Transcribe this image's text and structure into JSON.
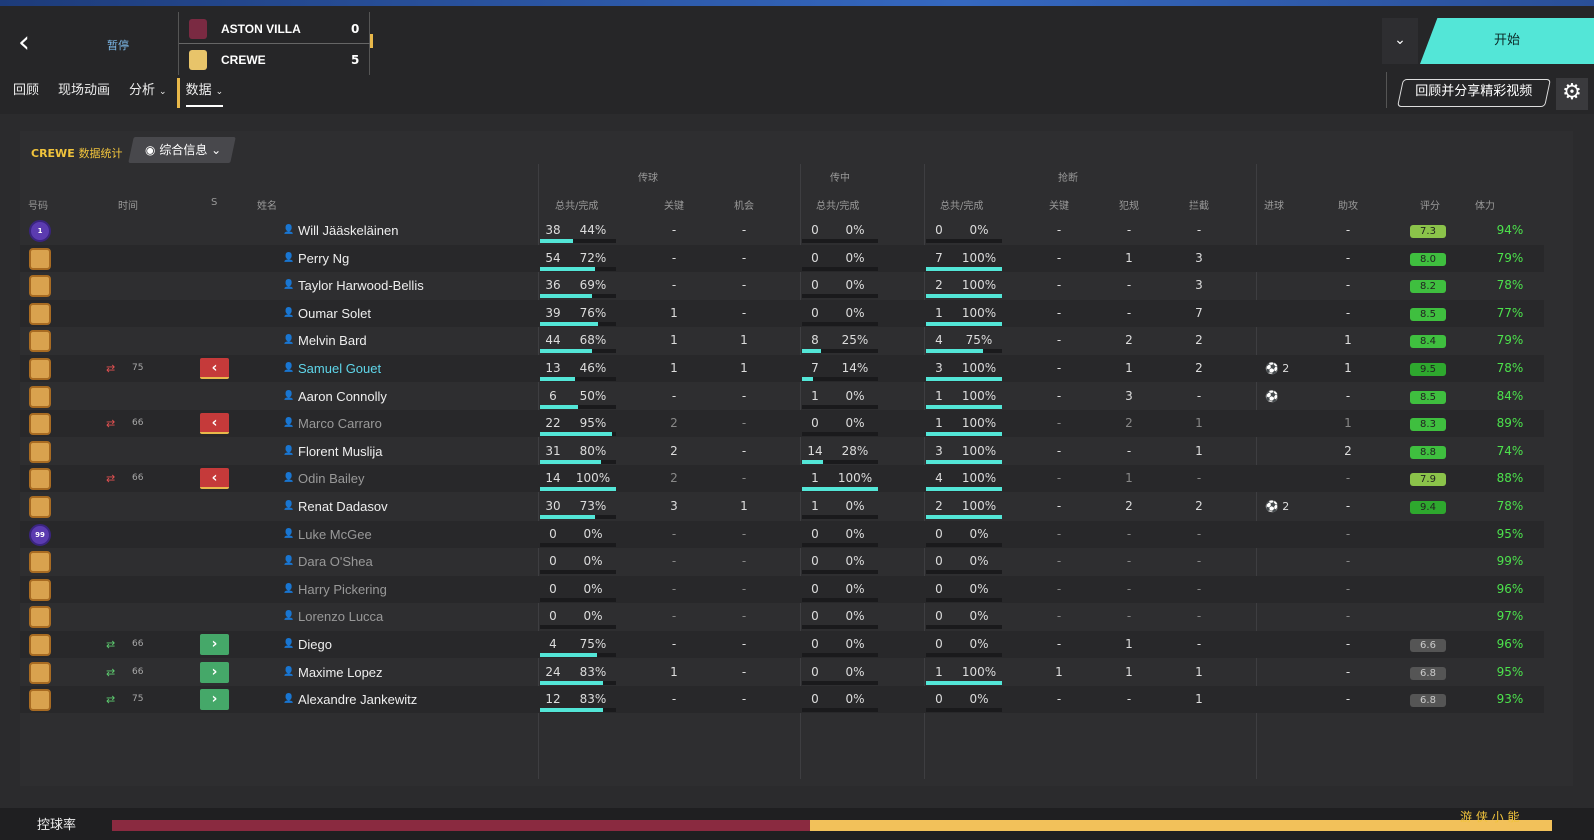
{
  "header": {
    "back_icon": "chevron-left-icon",
    "match_status": "暂停",
    "home_team": {
      "name": "ASTON VILLA",
      "score": "0",
      "crest_color": "#7a2a42"
    },
    "away_team": {
      "name": "CREWE",
      "score": "5",
      "crest_color": "#e8c46a"
    },
    "start_button": "开始",
    "share_button": "回顾并分享精彩视频",
    "tabs": [
      {
        "label": "回顾",
        "dropdown": false
      },
      {
        "label": "现场动画",
        "dropdown": false
      },
      {
        "label": "分析",
        "dropdown": true
      },
      {
        "label": "数据",
        "dropdown": true,
        "active": true
      }
    ]
  },
  "panel": {
    "team": "CREWE",
    "title": "数据统计",
    "view_selector": "综合信息",
    "groups": {
      "passing": "传球",
      "crossing": "传中",
      "tackles": "抢断"
    },
    "columns": {
      "number": "号码",
      "time": "时间",
      "s": "S",
      "name": "姓名",
      "pass_total": "总共/完成",
      "key": "关键",
      "chances": "机会",
      "cross_total": "总共/完成",
      "tackle_total": "总共/完成",
      "tackle_key": "关键",
      "fouls": "犯规",
      "interceptions": "拦截",
      "goals": "进球",
      "assists": "助攻",
      "rating": "评分",
      "stamina": "体力"
    }
  },
  "players": [
    {
      "no": "1",
      "gk": true,
      "name": "Will Jääskeläinen",
      "sub": false,
      "time": "",
      "sbtn": "",
      "pt": "38",
      "pp": "44%",
      "pf": 0.44,
      "key": "-",
      "ch": "-",
      "ct": "0",
      "cp": "0%",
      "cf": 0,
      "tt": "0",
      "tp": "0%",
      "tf": 0,
      "tk": "-",
      "fo": "-",
      "ic": "-",
      "gl": "",
      "as": "-",
      "rt": "7.3",
      "rc": "#8bc34a",
      "st": "94%"
    },
    {
      "no": "",
      "gk": false,
      "name": "Perry Ng",
      "sub": false,
      "time": "",
      "sbtn": "",
      "pt": "54",
      "pp": "72%",
      "pf": 0.72,
      "key": "-",
      "ch": "-",
      "ct": "0",
      "cp": "0%",
      "cf": 0,
      "tt": "7",
      "tp": "100%",
      "tf": 1,
      "tk": "-",
      "fo": "1",
      "ic": "3",
      "gl": "",
      "as": "-",
      "rt": "8.0",
      "rc": "#3fbf3f",
      "st": "79%"
    },
    {
      "no": "",
      "gk": false,
      "name": "Taylor Harwood-Bellis",
      "sub": false,
      "time": "",
      "sbtn": "",
      "pt": "36",
      "pp": "69%",
      "pf": 0.69,
      "key": "-",
      "ch": "-",
      "ct": "0",
      "cp": "0%",
      "cf": 0,
      "tt": "2",
      "tp": "100%",
      "tf": 1,
      "tk": "-",
      "fo": "-",
      "ic": "3",
      "gl": "",
      "as": "-",
      "rt": "8.2",
      "rc": "#3fbf3f",
      "st": "78%"
    },
    {
      "no": "",
      "gk": false,
      "name": "Oumar Solet",
      "sub": false,
      "time": "",
      "sbtn": "",
      "pt": "39",
      "pp": "76%",
      "pf": 0.76,
      "key": "1",
      "ch": "-",
      "ct": "0",
      "cp": "0%",
      "cf": 0,
      "tt": "1",
      "tp": "100%",
      "tf": 1,
      "tk": "-",
      "fo": "-",
      "ic": "7",
      "gl": "",
      "as": "-",
      "rt": "8.5",
      "rc": "#3fbf3f",
      "st": "77%"
    },
    {
      "no": "",
      "gk": false,
      "name": "Melvin Bard",
      "sub": false,
      "time": "",
      "sbtn": "",
      "pt": "44",
      "pp": "68%",
      "pf": 0.68,
      "key": "1",
      "ch": "1",
      "ct": "8",
      "cp": "25%",
      "cf": 0.25,
      "tt": "4",
      "tp": "75%",
      "tf": 0.75,
      "tk": "-",
      "fo": "2",
      "ic": "2",
      "gl": "",
      "as": "1",
      "rt": "8.4",
      "rc": "#3fbf3f",
      "st": "79%"
    },
    {
      "no": "",
      "gk": false,
      "name": "Samuel Gouet",
      "sub": "off",
      "hl": true,
      "time": "75",
      "sbtn": "out",
      "pt": "13",
      "pp": "46%",
      "pf": 0.46,
      "key": "1",
      "ch": "1",
      "ct": "7",
      "cp": "14%",
      "cf": 0.14,
      "tt": "3",
      "tp": "100%",
      "tf": 1,
      "tk": "-",
      "fo": "1",
      "ic": "2",
      "gl": "2",
      "as": "1",
      "rt": "9.5",
      "rc": "#2ea82e",
      "st": "78%"
    },
    {
      "no": "",
      "gk": false,
      "name": "Aaron Connolly",
      "sub": false,
      "time": "",
      "sbtn": "",
      "pt": "6",
      "pp": "50%",
      "pf": 0.5,
      "key": "-",
      "ch": "-",
      "ct": "1",
      "cp": "0%",
      "cf": 0,
      "tt": "1",
      "tp": "100%",
      "tf": 1,
      "tk": "-",
      "fo": "3",
      "ic": "-",
      "gl": "1",
      "as": "-",
      "rt": "8.5",
      "rc": "#3fbf3f",
      "st": "84%"
    },
    {
      "no": "",
      "gk": false,
      "name": "Marco Carraro",
      "sub": "off",
      "dim": true,
      "time": "66",
      "sbtn": "out",
      "pt": "22",
      "pp": "95%",
      "pf": 0.95,
      "key": "2",
      "ch": "-",
      "ct": "0",
      "cp": "0%",
      "cf": 0,
      "tt": "1",
      "tp": "100%",
      "tf": 1,
      "tk": "-",
      "fo": "2",
      "ic": "1",
      "gl": "",
      "as": "1",
      "rt": "8.3",
      "rc": "#3fbf3f",
      "st": "89%"
    },
    {
      "no": "",
      "gk": false,
      "name": "Florent Muslija",
      "sub": false,
      "time": "",
      "sbtn": "",
      "pt": "31",
      "pp": "80%",
      "pf": 0.8,
      "key": "2",
      "ch": "-",
      "ct": "14",
      "cp": "28%",
      "cf": 0.28,
      "tt": "3",
      "tp": "100%",
      "tf": 1,
      "tk": "-",
      "fo": "-",
      "ic": "1",
      "gl": "",
      "as": "2",
      "rt": "8.8",
      "rc": "#3fbf3f",
      "st": "74%"
    },
    {
      "no": "",
      "gk": false,
      "name": "Odin Bailey",
      "sub": "off",
      "dim": true,
      "time": "66",
      "sbtn": "out",
      "pt": "14",
      "pp": "100%",
      "pf": 1,
      "key": "2",
      "ch": "-",
      "ct": "1",
      "cp": "100%",
      "cf": 1,
      "tt": "4",
      "tp": "100%",
      "tf": 1,
      "tk": "-",
      "fo": "1",
      "ic": "-",
      "gl": "",
      "as": "-",
      "rt": "7.9",
      "rc": "#8bc34a",
      "st": "88%"
    },
    {
      "no": "",
      "gk": false,
      "name": "Renat Dadasov",
      "sub": false,
      "time": "",
      "sbtn": "",
      "pt": "30",
      "pp": "73%",
      "pf": 0.73,
      "key": "3",
      "ch": "1",
      "ct": "1",
      "cp": "0%",
      "cf": 0,
      "tt": "2",
      "tp": "100%",
      "tf": 1,
      "tk": "-",
      "fo": "2",
      "ic": "2",
      "gl": "2",
      "as": "-",
      "rt": "9.4",
      "rc": "#2ea82e",
      "st": "78%"
    },
    {
      "no": "99",
      "gk": true,
      "name": "Luke McGee",
      "sub": false,
      "dim": true,
      "time": "",
      "sbtn": "",
      "pt": "0",
      "pp": "0%",
      "pf": 0,
      "key": "-",
      "ch": "-",
      "ct": "0",
      "cp": "0%",
      "cf": 0,
      "tt": "0",
      "tp": "0%",
      "tf": 0,
      "tk": "-",
      "fo": "-",
      "ic": "-",
      "gl": "",
      "as": "-",
      "rt": "",
      "rc": "",
      "st": "95%"
    },
    {
      "no": "",
      "gk": false,
      "name": "Dara O'Shea",
      "sub": false,
      "dim": true,
      "time": "",
      "sbtn": "",
      "pt": "0",
      "pp": "0%",
      "pf": 0,
      "key": "-",
      "ch": "-",
      "ct": "0",
      "cp": "0%",
      "cf": 0,
      "tt": "0",
      "tp": "0%",
      "tf": 0,
      "tk": "-",
      "fo": "-",
      "ic": "-",
      "gl": "",
      "as": "-",
      "rt": "",
      "rc": "",
      "st": "99%"
    },
    {
      "no": "",
      "gk": false,
      "name": "Harry Pickering",
      "sub": false,
      "dim": true,
      "time": "",
      "sbtn": "",
      "pt": "0",
      "pp": "0%",
      "pf": 0,
      "key": "-",
      "ch": "-",
      "ct": "0",
      "cp": "0%",
      "cf": 0,
      "tt": "0",
      "tp": "0%",
      "tf": 0,
      "tk": "-",
      "fo": "-",
      "ic": "-",
      "gl": "",
      "as": "-",
      "rt": "",
      "rc": "",
      "st": "96%"
    },
    {
      "no": "",
      "gk": false,
      "name": "Lorenzo Lucca",
      "sub": false,
      "dim": true,
      "time": "",
      "sbtn": "",
      "pt": "0",
      "pp": "0%",
      "pf": 0,
      "key": "-",
      "ch": "-",
      "ct": "0",
      "cp": "0%",
      "cf": 0,
      "tt": "0",
      "tp": "0%",
      "tf": 0,
      "tk": "-",
      "fo": "-",
      "ic": "-",
      "gl": "",
      "as": "-",
      "rt": "",
      "rc": "",
      "st": "97%"
    },
    {
      "no": "",
      "gk": false,
      "name": "Diego",
      "sub": "on",
      "time": "66",
      "sbtn": "in",
      "pt": "4",
      "pp": "75%",
      "pf": 0.75,
      "key": "-",
      "ch": "-",
      "ct": "0",
      "cp": "0%",
      "cf": 0,
      "tt": "0",
      "tp": "0%",
      "tf": 0,
      "tk": "-",
      "fo": "1",
      "ic": "-",
      "gl": "",
      "as": "-",
      "rt": "6.6",
      "rc": "#555",
      "st": "96%"
    },
    {
      "no": "",
      "gk": false,
      "name": "Maxime Lopez",
      "sub": "on",
      "time": "66",
      "sbtn": "in",
      "pt": "24",
      "pp": "83%",
      "pf": 0.83,
      "key": "1",
      "ch": "-",
      "ct": "0",
      "cp": "0%",
      "cf": 0,
      "tt": "1",
      "tp": "100%",
      "tf": 1,
      "tk": "1",
      "fo": "1",
      "ic": "1",
      "gl": "",
      "as": "-",
      "rt": "6.8",
      "rc": "#555",
      "st": "95%"
    },
    {
      "no": "",
      "gk": false,
      "name": "Alexandre Jankewitz",
      "sub": "on",
      "time": "75",
      "sbtn": "in",
      "pt": "12",
      "pp": "83%",
      "pf": 0.83,
      "key": "-",
      "ch": "-",
      "ct": "0",
      "cp": "0%",
      "cf": 0,
      "tt": "0",
      "tp": "0%",
      "tf": 0,
      "tk": "-",
      "fo": "-",
      "ic": "1",
      "gl": "",
      "as": "-",
      "rt": "6.8",
      "rc": "#555",
      "st": "93%"
    }
  ],
  "possession": {
    "label": "控球率",
    "home_fraction": 0.485,
    "home_color": "#8a2a40",
    "away_color": "#f2c15a"
  },
  "watermark": "游 侠 小 能"
}
